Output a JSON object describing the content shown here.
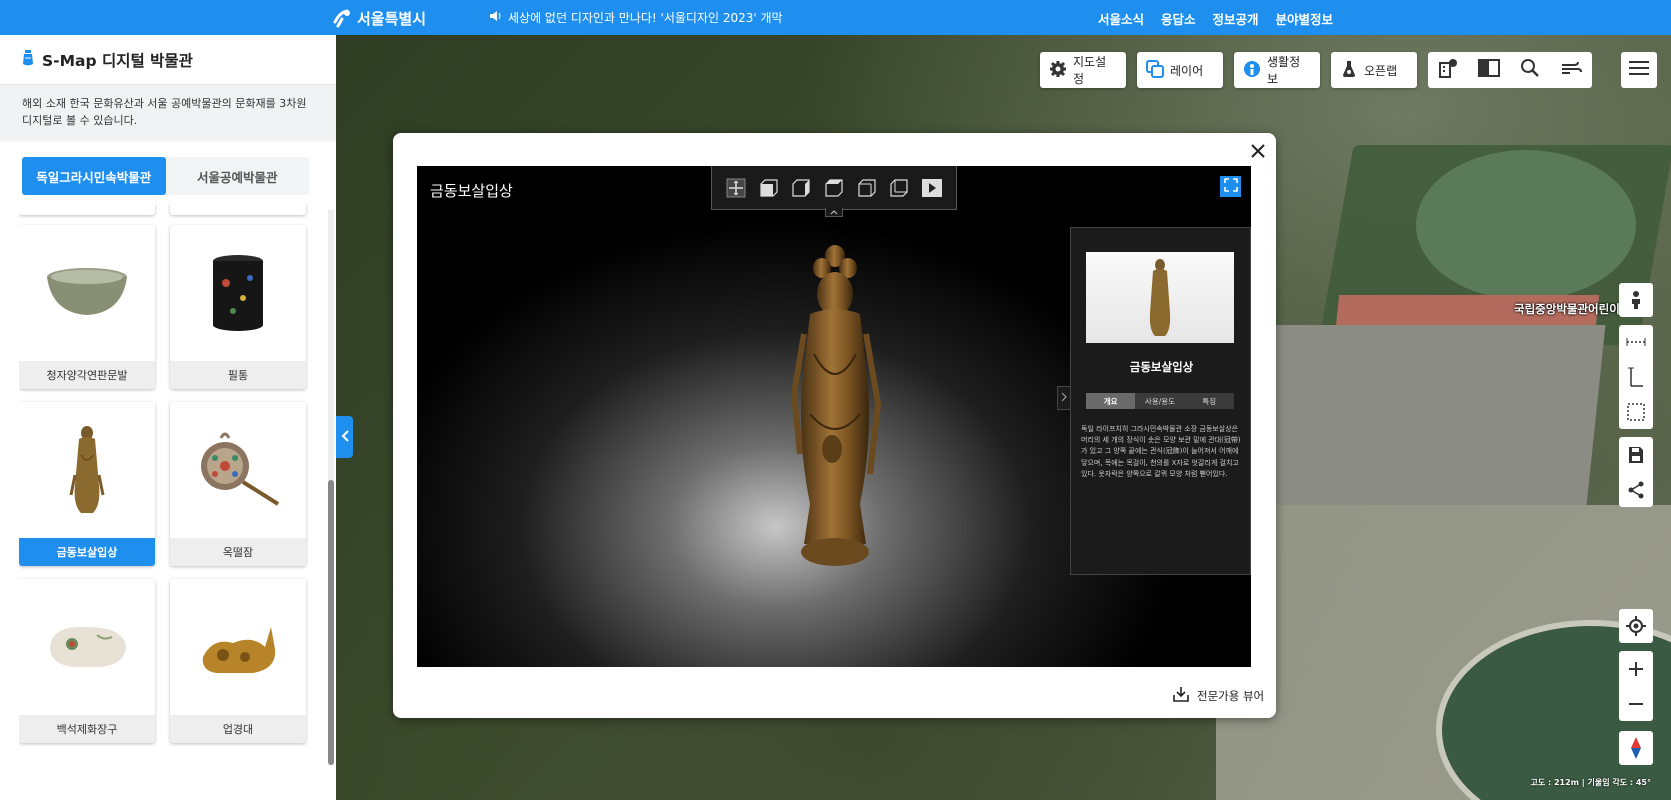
{
  "topbar": {
    "logo": "서울특별시",
    "notice": "세상에 없던 디자인과 만나다! '서울디자인 2023' 개막",
    "nav": [
      "서울소식",
      "응답소",
      "정보공개",
      "분야별정보"
    ]
  },
  "sidebar": {
    "title": "S-Map 디지털 박물관",
    "description": "해외 소재 한국 문화유산과 서울 공예박물관의 문화재를 3차원 디지털로 볼 수 있습니다.",
    "tabs": [
      {
        "label": "독일그라시민속박물관",
        "active": true
      },
      {
        "label": "서울공예박물관",
        "active": false
      }
    ],
    "items": [
      {
        "label": "청자양각연판문발",
        "icon": "celadon-bowl"
      },
      {
        "label": "필통",
        "icon": "brush-holder"
      },
      {
        "label": "금동보살입상",
        "icon": "bodhisattva-statue",
        "selected": true
      },
      {
        "label": "옥떨잠",
        "icon": "jade-hairpin"
      },
      {
        "label": "백석제화장구",
        "icon": "cosmetic-case"
      },
      {
        "label": "업경대",
        "icon": "mirror-stand"
      }
    ]
  },
  "map": {
    "label": "국립중앙박물관어린이",
    "status": "고도 : 212m | 기울임 각도 : 45°"
  },
  "toolbar": {
    "map_settings": "지도설정",
    "layer": "레이어",
    "life_info": "생활정보",
    "open_lab": "오픈랩"
  },
  "viewer": {
    "title": "금동보살입상",
    "panel_title": "금동보살입상",
    "panel_tabs": [
      {
        "label": "개요",
        "active": true
      },
      {
        "label": "사용/용도",
        "active": false
      },
      {
        "label": "특징",
        "active": false
      }
    ],
    "panel_text": "독일 라이프치히 그라시민속박물관 소장 금동보살상은 머리의 세 개의 장식이 솟은 모양 보관 밑에 관대(冠帶)가 있고 그 양쪽 끝에는 관식(冠飾)이 늘어져서 어깨에 닿으며, 목에는 목걸이, 천의를 X자로 엇갈리게 걸치고 있다. 옷자락은 양쪽으로 갈퀴 모양 처럼 뻗어있다.",
    "expert_viewer": "전문가용 뷰어"
  },
  "colors": {
    "accent": "#1e8fef",
    "viewer_bg": "#000000",
    "panel_bg": "#1b1b1b"
  }
}
